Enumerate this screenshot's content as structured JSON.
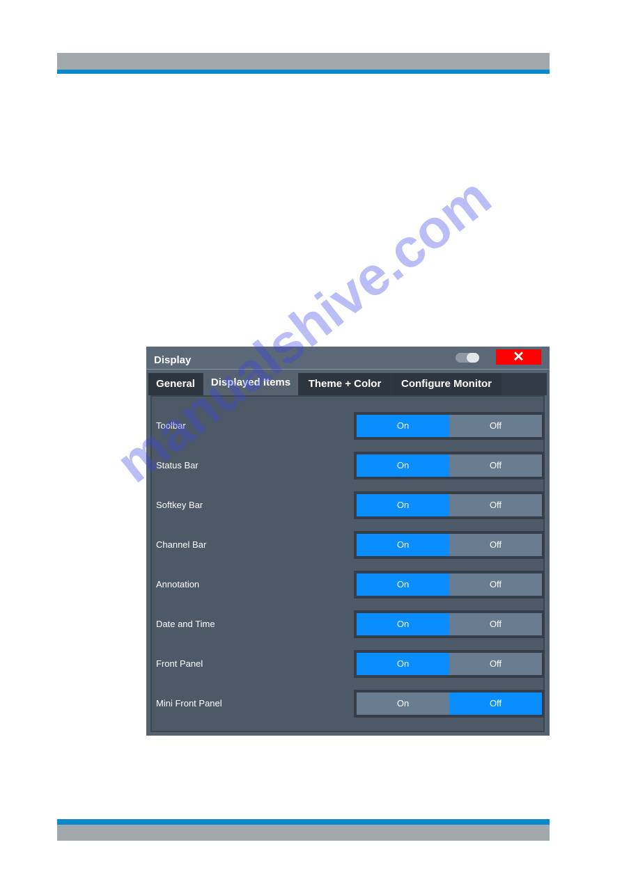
{
  "dialog": {
    "title": "Display",
    "close_label": "✕",
    "tabs": [
      {
        "label": "General",
        "active": false
      },
      {
        "label": "Displayed Items",
        "active": true
      },
      {
        "label": "Theme + Color",
        "active": false
      },
      {
        "label": "Configure Monitor",
        "active": false
      }
    ],
    "options": {
      "on": "On",
      "off": "Off"
    },
    "rows": [
      {
        "label": "Toolbar",
        "value": "On"
      },
      {
        "label": "Status Bar",
        "value": "On"
      },
      {
        "label": "Softkey Bar",
        "value": "On"
      },
      {
        "label": "Channel Bar",
        "value": "On"
      },
      {
        "label": "Annotation",
        "value": "On"
      },
      {
        "label": "Date and Time",
        "value": "On"
      },
      {
        "label": "Front Panel",
        "value": "On"
      },
      {
        "label": "Mini Front Panel",
        "value": "Off"
      }
    ]
  },
  "watermark": "manualshive.com"
}
